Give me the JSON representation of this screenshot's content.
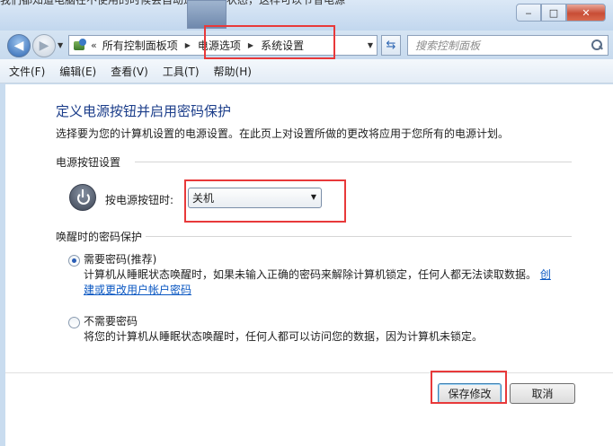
{
  "background": {
    "partial_text": "我们都知道电脑在不使用的时候会自动进入睡眠状态，这样可以节省电源"
  },
  "window": {
    "minimize": "‒",
    "maximize": "□",
    "close": "✕"
  },
  "address_bar": {
    "prefix": "«",
    "crumbs": [
      "所有控制面板项",
      "电源选项",
      "系统设置"
    ],
    "search_placeholder": "搜索控制面板"
  },
  "menu": {
    "items": [
      "文件(F)",
      "编辑(E)",
      "查看(V)",
      "工具(T)",
      "帮助(H)"
    ]
  },
  "page": {
    "title": "定义电源按钮并启用密码保护",
    "description": "选择要为您的计算机设置的电源设置。在此页上对设置所做的更改将应用于您所有的电源计划。"
  },
  "power_section": {
    "heading": "电源按钮设置",
    "label": "按电源按钮时:",
    "selected_value": "关机"
  },
  "password_section": {
    "heading": "唤醒时的密码保护",
    "options": [
      {
        "label": "需要密码(推荐)",
        "description": "计算机从睡眠状态唤醒时，如果未输入正确的密码来解除计算机锁定，任何人都无法读取数据。",
        "link_line1": "创",
        "link_line2": "建或更改用户帐户密码",
        "checked": true
      },
      {
        "label": "不需要密码",
        "description": "将您的计算机从睡眠状态唤醒时，任何人都可以访问您的数据，因为计算机未锁定。",
        "checked": false
      }
    ]
  },
  "buttons": {
    "save": "保存修改",
    "cancel": "取消"
  },
  "colors": {
    "title_blue": "#1b3d8a",
    "link_blue": "#0a57c2",
    "highlight_red": "#e8393a"
  }
}
